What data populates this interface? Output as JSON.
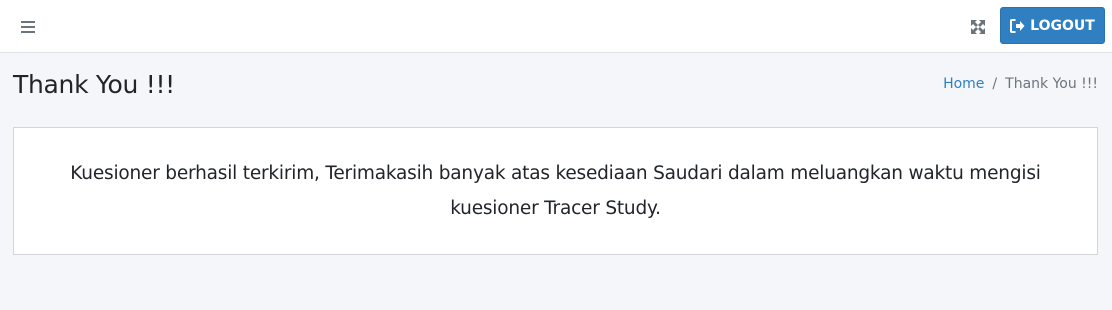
{
  "navbar": {
    "menu_icon": "hamburger-menu-icon",
    "fullscreen_icon": "expand-arrows-icon",
    "logout_label": "LOGOUT",
    "logout_icon": "sign-out-icon",
    "accent_color": "#2f7fc1"
  },
  "content_header": {
    "title": "Thank You !!!",
    "breadcrumb": {
      "home": "Home",
      "separator": "/",
      "current": "Thank You !!!"
    }
  },
  "card": {
    "message": "Kuesioner berhasil terkirim, Terimakasih banyak atas kesediaan Saudari dalam meluangkan waktu mengisi kuesioner Tracer Study."
  }
}
